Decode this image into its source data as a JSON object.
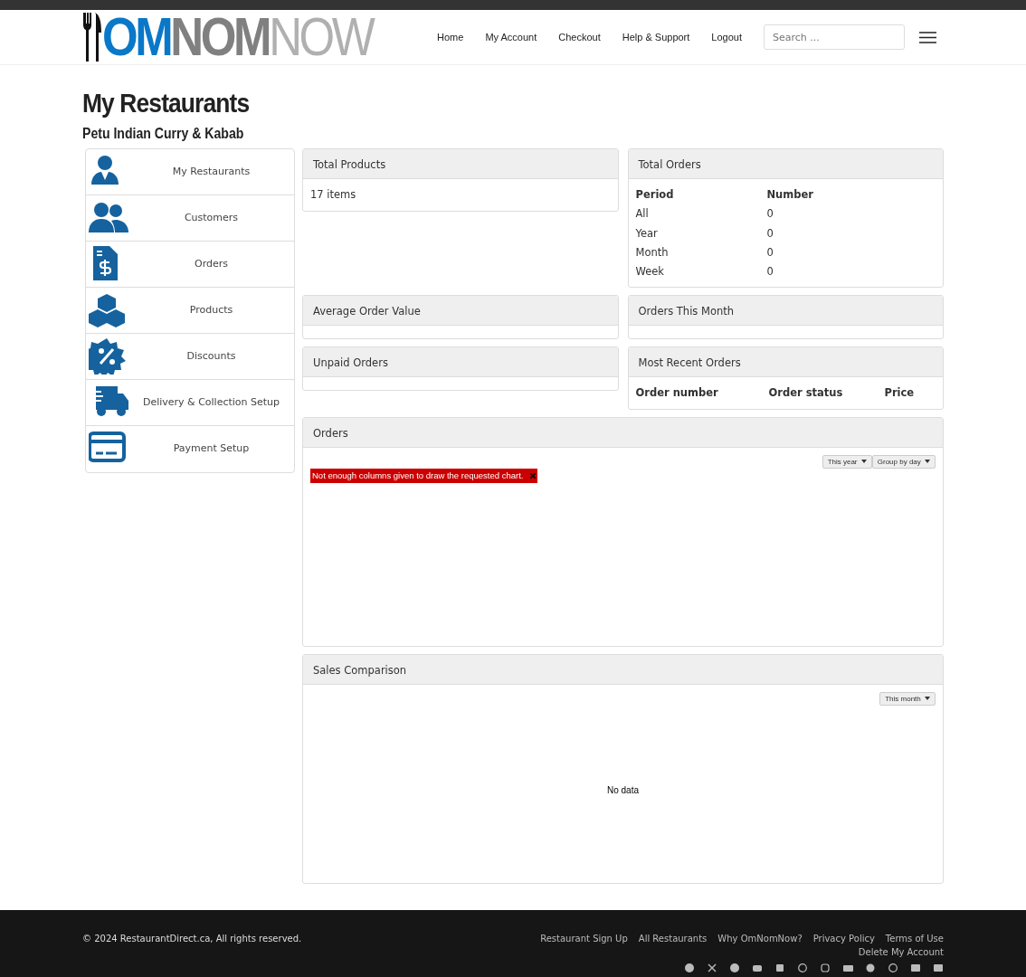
{
  "logo": {
    "parts": [
      "OM",
      "NOM",
      "NOW"
    ]
  },
  "nav": {
    "links": [
      "Home",
      "My Account",
      "Checkout",
      "Help & Support",
      "Logout"
    ],
    "search": {
      "placeholder": "Search ..."
    }
  },
  "page": {
    "title": "My Restaurants",
    "subtitle": "Petu Indian Curry & Kabab"
  },
  "sidebar": {
    "items": [
      {
        "label": "My Restaurants"
      },
      {
        "label": "Customers"
      },
      {
        "label": "Orders"
      },
      {
        "label": "Products"
      },
      {
        "label": "Discounts"
      },
      {
        "label": "Delivery & Collection Setup"
      },
      {
        "label": "Payment Setup"
      }
    ]
  },
  "total_products": {
    "title": "Total Products",
    "value": "17 items"
  },
  "total_orders": {
    "title": "Total Orders",
    "columns": [
      "Period",
      "Number"
    ],
    "rows": [
      [
        "All",
        "0"
      ],
      [
        "Year",
        "0"
      ],
      [
        "Month",
        "0"
      ],
      [
        "Week",
        "0"
      ]
    ]
  },
  "average_order_value": {
    "title": "Average Order Value"
  },
  "orders_this_month": {
    "title": "Orders This Month"
  },
  "unpaid_orders": {
    "title": "Unpaid Orders"
  },
  "most_recent_orders": {
    "title": "Most Recent Orders",
    "columns": [
      "Order number",
      "Order status",
      "Price"
    ]
  },
  "orders_chart": {
    "title": "Orders",
    "dropdowns": [
      "This year",
      "Group by day"
    ],
    "error": "Not enough columns given to draw the requested chart."
  },
  "sales_comparison": {
    "title": "Sales Comparison",
    "dropdowns": [
      "This month"
    ],
    "message": "No data"
  },
  "footer": {
    "copyright": "© 2024 RestaurantDirect.ca, All rights reserved.",
    "links": [
      "Restaurant Sign Up",
      "All Restaurants",
      "Why OmNomNow?",
      "Privacy Policy",
      "Terms of Use",
      "Delete My Account"
    ]
  }
}
